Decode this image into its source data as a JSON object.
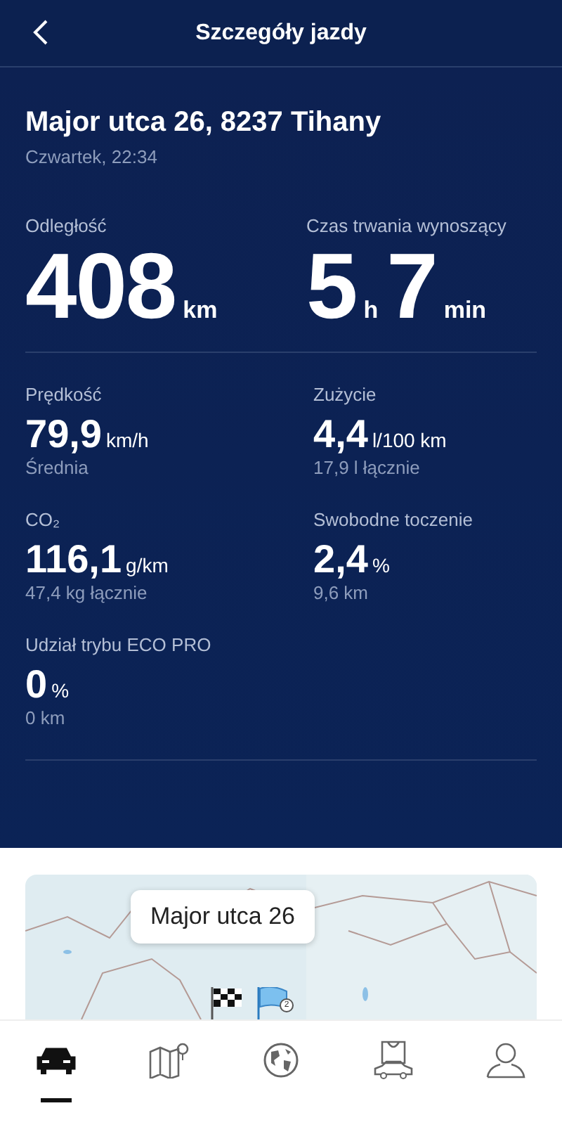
{
  "header": {
    "title": "Szczegóły jazdy"
  },
  "trip": {
    "address": "Major utca 26, 8237 Tihany",
    "date": "Czwartek, 22:34"
  },
  "summary": [
    {
      "label": "Odległość",
      "parts": [
        {
          "value": "408",
          "unit": "km"
        }
      ]
    },
    {
      "label": "Czas trwania wynoszący",
      "parts": [
        {
          "value": "5",
          "unit": "h"
        },
        {
          "value": "7",
          "unit": "min"
        }
      ]
    }
  ],
  "stats": [
    {
      "label": "Prędkość",
      "value": "79,9",
      "unit": "km/h",
      "note": "Średnia"
    },
    {
      "label": "Zużycie",
      "value": "4,4",
      "unit": "l/100 km",
      "note": "17,9 l łącznie"
    },
    {
      "label": "CO₂",
      "value": "116,1",
      "unit": "g/km",
      "note": "47,4 kg łącznie"
    },
    {
      "label": "Swobodne toczenie",
      "value": "2,4",
      "unit": "%",
      "note": "9,6 km"
    },
    {
      "label": "Udział trybu ECO PRO",
      "value": "0",
      "unit": "%",
      "note": "0 km"
    }
  ],
  "map": {
    "kind": "picture",
    "callout": "Major utca 26",
    "marker_badge": "2"
  },
  "nav": [
    {
      "selected": true
    },
    {
      "selected": false
    },
    {
      "selected": false
    },
    {
      "selected": false
    },
    {
      "selected": false
    }
  ]
}
